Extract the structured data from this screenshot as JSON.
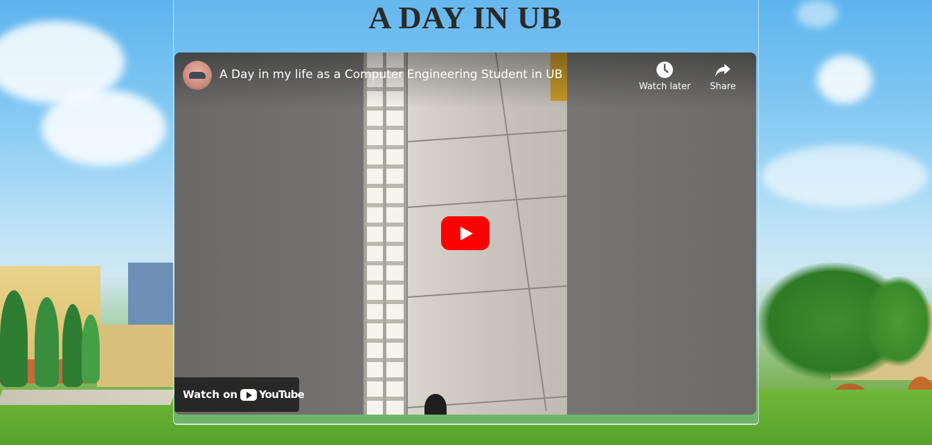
{
  "page": {
    "title": "A DAY IN UB"
  },
  "video": {
    "title": "A Day in my life as a Computer Engineering Student in UB",
    "channel_avatar_icon": "channel-avatar-icon",
    "actions": [
      {
        "label": "Watch later",
        "icon": "clock-icon"
      },
      {
        "label": "Share",
        "icon": "share-arrow-icon"
      }
    ],
    "play_icon": "play-icon",
    "watch_on_label": "Watch on",
    "youtube_logo_text": "YouTube"
  },
  "colors": {
    "play_button": "#ff0000",
    "title_text": "#2a2a2a",
    "player_bg": "#6e6d6c"
  }
}
